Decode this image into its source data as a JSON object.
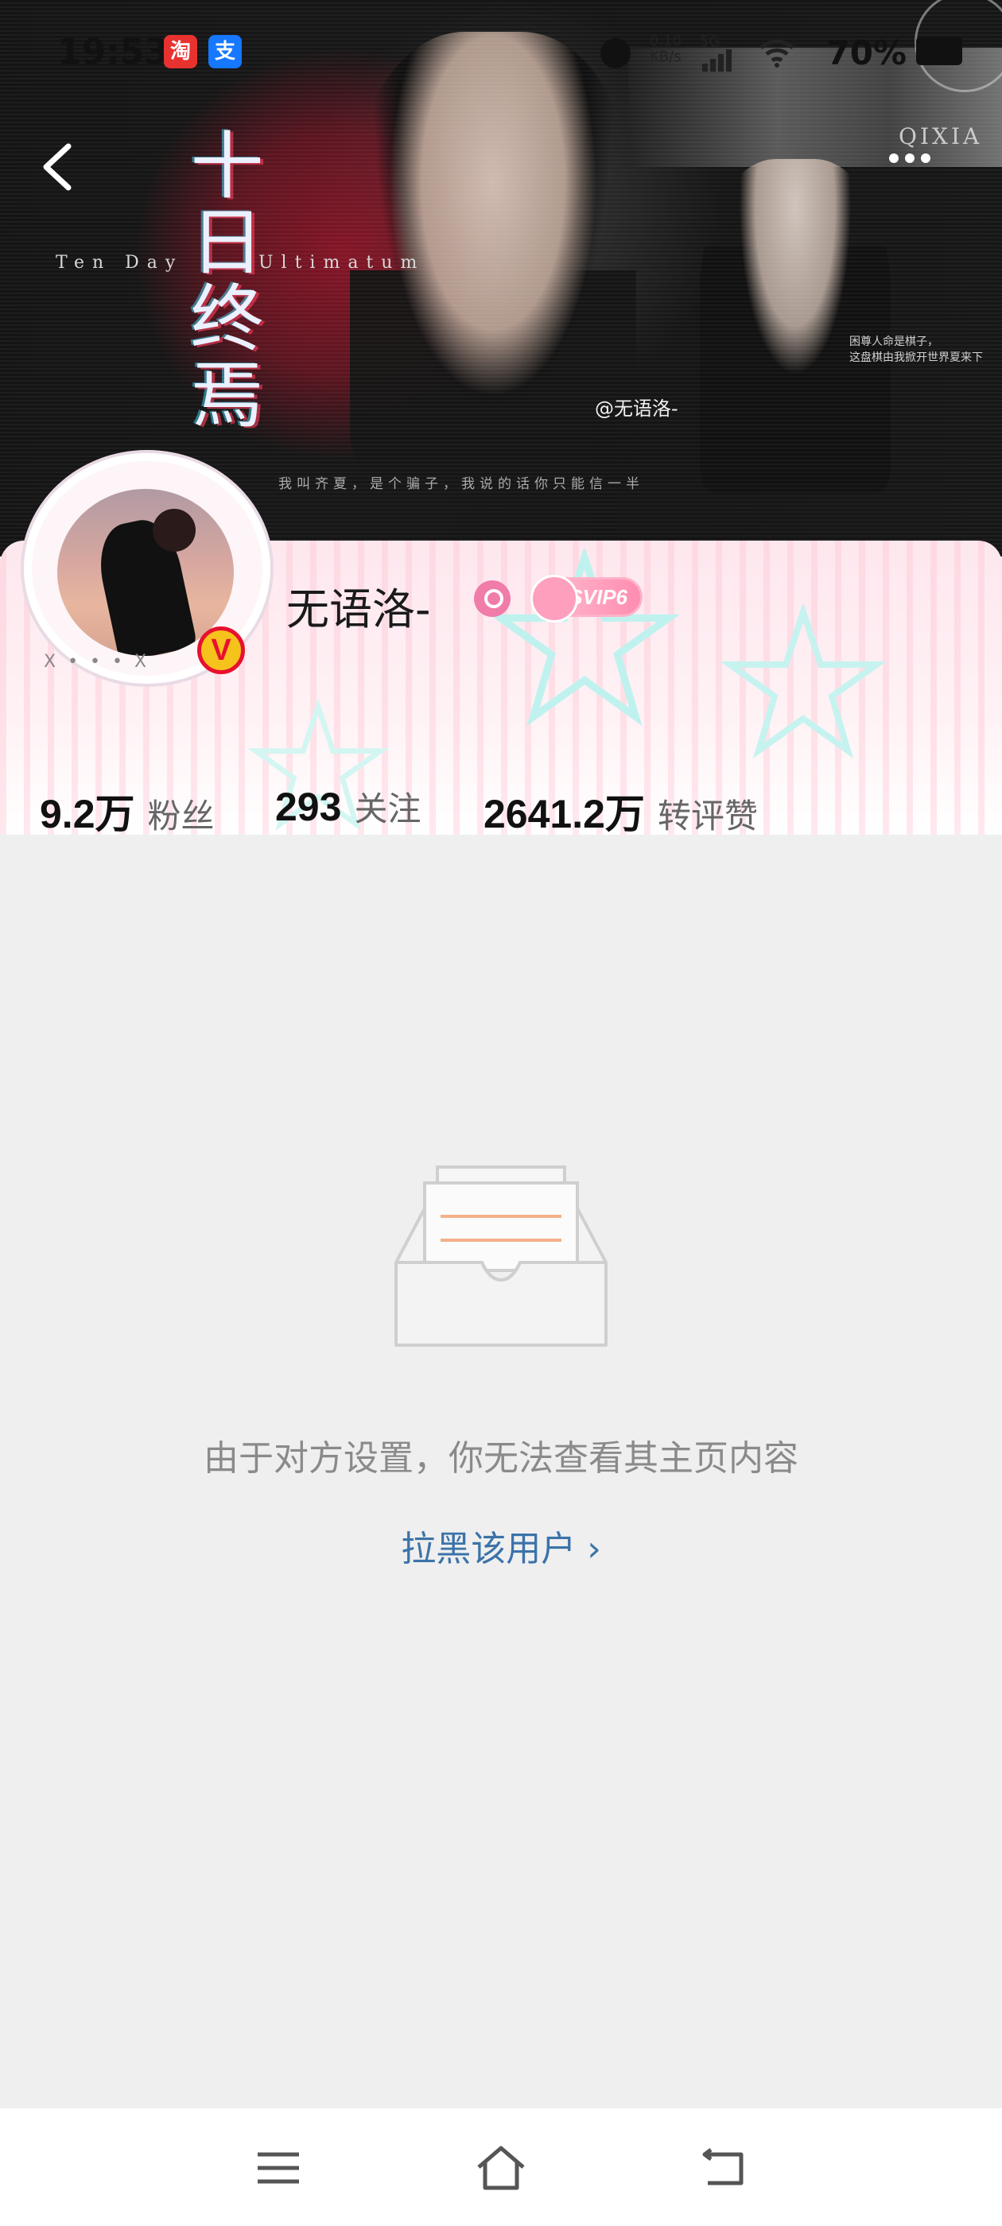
{
  "status_bar": {
    "time": "19:53",
    "taobao_icon_text": "淘",
    "alipay_icon_text": "支",
    "net_speed_top": "0.10",
    "net_speed_bottom": "KB/s",
    "network": "5G",
    "battery_percent": "70%"
  },
  "banner": {
    "title_cn": "十日终焉",
    "title_en_left": "Ten Day",
    "title_en_right": "Ultimatum",
    "watermark": "@无语洛-",
    "quote": "我叫齐夏，是个骗子，我说的话你只能信一半",
    "corner_logo": "QIXIA",
    "side_note_line1": "困尊人命是棋子，",
    "side_note_line2": "这盘棋由我掀开世界夏来下"
  },
  "profile": {
    "username": "无语洛-",
    "svip_label": "SVIP6",
    "verify_mark": "V",
    "frame_text": "X • • • X"
  },
  "stats": [
    {
      "value": "9.2万",
      "label": "粉丝"
    },
    {
      "value": "293",
      "label": "关注"
    },
    {
      "value": "2641.2万",
      "label": "转评赞"
    }
  ],
  "empty_state": {
    "message": "由于对方设置，你无法查看其主页内容",
    "block_link": "拉黑该用户 ›"
  },
  "colors": {
    "link": "#3b73a8",
    "verify_badge": "#f6c21c",
    "svip": "#ff8db0",
    "page_bg": "#efefef"
  }
}
